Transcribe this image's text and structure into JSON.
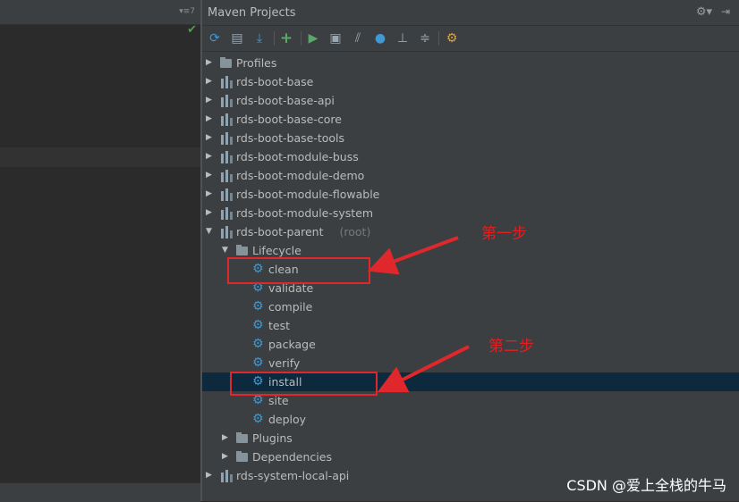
{
  "panel": {
    "title": "Maven Projects",
    "left_marker": "▾≡7"
  },
  "toolbar": [
    "refresh-icon",
    "add-folder-icon",
    "download-icon",
    "add-icon",
    "run-icon",
    "execute-goal-icon",
    "toggle-offline-icon",
    "skip-tests-icon",
    "dependency-diagram-icon",
    "collapse-icon",
    "settings-icon"
  ],
  "tree": [
    {
      "label": "Profiles",
      "kind": "folder",
      "level": 0,
      "arrow": "▶"
    },
    {
      "label": "rds-boot-base",
      "kind": "module",
      "level": 0,
      "arrow": "▶"
    },
    {
      "label": "rds-boot-base-api",
      "kind": "module",
      "level": 0,
      "arrow": "▶"
    },
    {
      "label": "rds-boot-base-core",
      "kind": "module",
      "level": 0,
      "arrow": "▶"
    },
    {
      "label": "rds-boot-base-tools",
      "kind": "module",
      "level": 0,
      "arrow": "▶"
    },
    {
      "label": "rds-boot-module-buss",
      "kind": "module",
      "level": 0,
      "arrow": "▶"
    },
    {
      "label": "rds-boot-module-demo",
      "kind": "module",
      "level": 0,
      "arrow": "▶"
    },
    {
      "label": "rds-boot-module-flowable",
      "kind": "module",
      "level": 0,
      "arrow": "▶"
    },
    {
      "label": "rds-boot-module-system",
      "kind": "module",
      "level": 0,
      "arrow": "▶"
    },
    {
      "label": "rds-boot-parent",
      "suffix": "(root)",
      "kind": "module",
      "level": 0,
      "arrow": "▼"
    },
    {
      "label": "Lifecycle",
      "kind": "folder",
      "level": 1,
      "arrow": "▼"
    },
    {
      "label": "clean",
      "kind": "goal",
      "level": 2
    },
    {
      "label": "validate",
      "kind": "goal",
      "level": 2
    },
    {
      "label": "compile",
      "kind": "goal",
      "level": 2
    },
    {
      "label": "test",
      "kind": "goal",
      "level": 2
    },
    {
      "label": "package",
      "kind": "goal",
      "level": 2
    },
    {
      "label": "verify",
      "kind": "goal",
      "level": 2
    },
    {
      "label": "install",
      "kind": "goal",
      "level": 2,
      "selected": true
    },
    {
      "label": "site",
      "kind": "goal",
      "level": 2
    },
    {
      "label": "deploy",
      "kind": "goal",
      "level": 2
    },
    {
      "label": "Plugins",
      "kind": "folder",
      "level": 1,
      "arrow": "▶"
    },
    {
      "label": "Dependencies",
      "kind": "folder",
      "level": 1,
      "arrow": "▶"
    },
    {
      "label": "rds-system-local-api",
      "kind": "module",
      "level": 0,
      "arrow": "▶"
    }
  ],
  "annotations": {
    "step1": "第一步",
    "step2": "第二步"
  },
  "watermark": "CSDN @爱上全栈的牛马",
  "colors": {
    "accent_gear": "#3e99d4",
    "annotation_red": "#e0282c",
    "selection": "#0d293e"
  }
}
